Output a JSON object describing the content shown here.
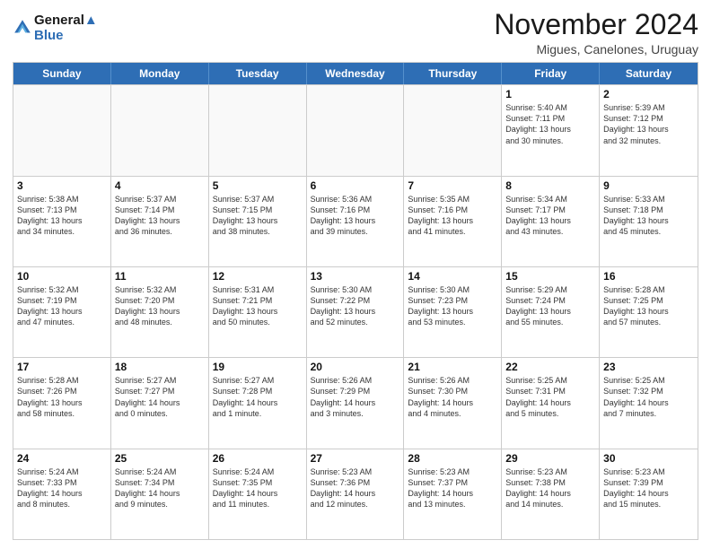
{
  "header": {
    "logo_line1": "General",
    "logo_line2": "Blue",
    "month": "November 2024",
    "location": "Migues, Canelones, Uruguay"
  },
  "weekdays": [
    "Sunday",
    "Monday",
    "Tuesday",
    "Wednesday",
    "Thursday",
    "Friday",
    "Saturday"
  ],
  "rows": [
    [
      {
        "day": "",
        "text": "",
        "empty": true
      },
      {
        "day": "",
        "text": "",
        "empty": true
      },
      {
        "day": "",
        "text": "",
        "empty": true
      },
      {
        "day": "",
        "text": "",
        "empty": true
      },
      {
        "day": "",
        "text": "",
        "empty": true
      },
      {
        "day": "1",
        "text": "Sunrise: 5:40 AM\nSunset: 7:11 PM\nDaylight: 13 hours\nand 30 minutes.",
        "empty": false
      },
      {
        "day": "2",
        "text": "Sunrise: 5:39 AM\nSunset: 7:12 PM\nDaylight: 13 hours\nand 32 minutes.",
        "empty": false
      }
    ],
    [
      {
        "day": "3",
        "text": "Sunrise: 5:38 AM\nSunset: 7:13 PM\nDaylight: 13 hours\nand 34 minutes.",
        "empty": false
      },
      {
        "day": "4",
        "text": "Sunrise: 5:37 AM\nSunset: 7:14 PM\nDaylight: 13 hours\nand 36 minutes.",
        "empty": false
      },
      {
        "day": "5",
        "text": "Sunrise: 5:37 AM\nSunset: 7:15 PM\nDaylight: 13 hours\nand 38 minutes.",
        "empty": false
      },
      {
        "day": "6",
        "text": "Sunrise: 5:36 AM\nSunset: 7:16 PM\nDaylight: 13 hours\nand 39 minutes.",
        "empty": false
      },
      {
        "day": "7",
        "text": "Sunrise: 5:35 AM\nSunset: 7:16 PM\nDaylight: 13 hours\nand 41 minutes.",
        "empty": false
      },
      {
        "day": "8",
        "text": "Sunrise: 5:34 AM\nSunset: 7:17 PM\nDaylight: 13 hours\nand 43 minutes.",
        "empty": false
      },
      {
        "day": "9",
        "text": "Sunrise: 5:33 AM\nSunset: 7:18 PM\nDaylight: 13 hours\nand 45 minutes.",
        "empty": false
      }
    ],
    [
      {
        "day": "10",
        "text": "Sunrise: 5:32 AM\nSunset: 7:19 PM\nDaylight: 13 hours\nand 47 minutes.",
        "empty": false
      },
      {
        "day": "11",
        "text": "Sunrise: 5:32 AM\nSunset: 7:20 PM\nDaylight: 13 hours\nand 48 minutes.",
        "empty": false
      },
      {
        "day": "12",
        "text": "Sunrise: 5:31 AM\nSunset: 7:21 PM\nDaylight: 13 hours\nand 50 minutes.",
        "empty": false
      },
      {
        "day": "13",
        "text": "Sunrise: 5:30 AM\nSunset: 7:22 PM\nDaylight: 13 hours\nand 52 minutes.",
        "empty": false
      },
      {
        "day": "14",
        "text": "Sunrise: 5:30 AM\nSunset: 7:23 PM\nDaylight: 13 hours\nand 53 minutes.",
        "empty": false
      },
      {
        "day": "15",
        "text": "Sunrise: 5:29 AM\nSunset: 7:24 PM\nDaylight: 13 hours\nand 55 minutes.",
        "empty": false
      },
      {
        "day": "16",
        "text": "Sunrise: 5:28 AM\nSunset: 7:25 PM\nDaylight: 13 hours\nand 57 minutes.",
        "empty": false
      }
    ],
    [
      {
        "day": "17",
        "text": "Sunrise: 5:28 AM\nSunset: 7:26 PM\nDaylight: 13 hours\nand 58 minutes.",
        "empty": false
      },
      {
        "day": "18",
        "text": "Sunrise: 5:27 AM\nSunset: 7:27 PM\nDaylight: 14 hours\nand 0 minutes.",
        "empty": false
      },
      {
        "day": "19",
        "text": "Sunrise: 5:27 AM\nSunset: 7:28 PM\nDaylight: 14 hours\nand 1 minute.",
        "empty": false
      },
      {
        "day": "20",
        "text": "Sunrise: 5:26 AM\nSunset: 7:29 PM\nDaylight: 14 hours\nand 3 minutes.",
        "empty": false
      },
      {
        "day": "21",
        "text": "Sunrise: 5:26 AM\nSunset: 7:30 PM\nDaylight: 14 hours\nand 4 minutes.",
        "empty": false
      },
      {
        "day": "22",
        "text": "Sunrise: 5:25 AM\nSunset: 7:31 PM\nDaylight: 14 hours\nand 5 minutes.",
        "empty": false
      },
      {
        "day": "23",
        "text": "Sunrise: 5:25 AM\nSunset: 7:32 PM\nDaylight: 14 hours\nand 7 minutes.",
        "empty": false
      }
    ],
    [
      {
        "day": "24",
        "text": "Sunrise: 5:24 AM\nSunset: 7:33 PM\nDaylight: 14 hours\nand 8 minutes.",
        "empty": false
      },
      {
        "day": "25",
        "text": "Sunrise: 5:24 AM\nSunset: 7:34 PM\nDaylight: 14 hours\nand 9 minutes.",
        "empty": false
      },
      {
        "day": "26",
        "text": "Sunrise: 5:24 AM\nSunset: 7:35 PM\nDaylight: 14 hours\nand 11 minutes.",
        "empty": false
      },
      {
        "day": "27",
        "text": "Sunrise: 5:23 AM\nSunset: 7:36 PM\nDaylight: 14 hours\nand 12 minutes.",
        "empty": false
      },
      {
        "day": "28",
        "text": "Sunrise: 5:23 AM\nSunset: 7:37 PM\nDaylight: 14 hours\nand 13 minutes.",
        "empty": false
      },
      {
        "day": "29",
        "text": "Sunrise: 5:23 AM\nSunset: 7:38 PM\nDaylight: 14 hours\nand 14 minutes.",
        "empty": false
      },
      {
        "day": "30",
        "text": "Sunrise: 5:23 AM\nSunset: 7:39 PM\nDaylight: 14 hours\nand 15 minutes.",
        "empty": false
      }
    ]
  ]
}
